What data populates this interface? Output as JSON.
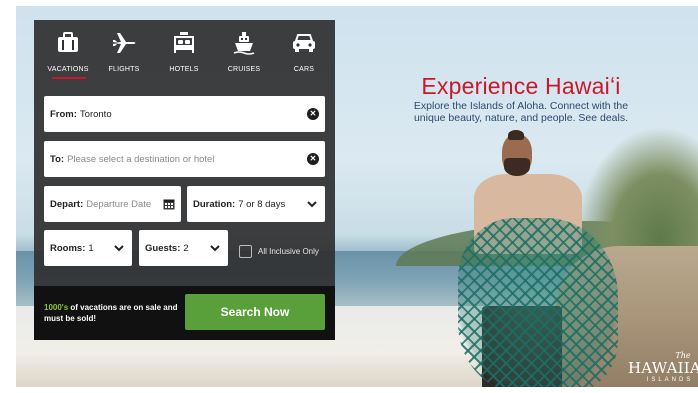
{
  "tabs": [
    {
      "label": "VACATIONS",
      "icon": "suitcase-icon",
      "active": true
    },
    {
      "label": "FLIGHTS",
      "icon": "airplane-icon",
      "active": false
    },
    {
      "label": "HOTELS",
      "icon": "bed-icon",
      "active": false
    },
    {
      "label": "CRUISES",
      "icon": "ship-icon",
      "active": false
    },
    {
      "label": "CARS",
      "icon": "car-icon",
      "active": false
    }
  ],
  "form": {
    "from_label": "From:",
    "from_value": "Toronto",
    "to_label": "To:",
    "to_placeholder": "Please select a destination or hotel",
    "depart_label": "Depart:",
    "depart_placeholder": "Departure Date",
    "duration_label": "Duration:",
    "duration_value": "7 or 8 days",
    "rooms_label": "Rooms:",
    "rooms_value": "1",
    "guests_label": "Guests:",
    "guests_value": "2",
    "all_inclusive_label": "All Inclusive Only"
  },
  "promo": {
    "highlight": "1000's",
    "text": " of vacations are on sale and must be sold!"
  },
  "search_button": "Search Now",
  "ad": {
    "title": "Experience Hawaiʻi",
    "subtitle_line1": "Explore the Islands of Aloha. Connect with the",
    "subtitle_line2": "unique beauty, nature, and people. See deals.",
    "logo_the": "The",
    "logo_main": "HAWAIIAN",
    "logo_islands": "ISLANDS"
  },
  "colors": {
    "accent_red": "#c8192a",
    "button_green": "#5aa03a",
    "promo_green": "#8fc43f",
    "widget_bg": "#303032"
  }
}
